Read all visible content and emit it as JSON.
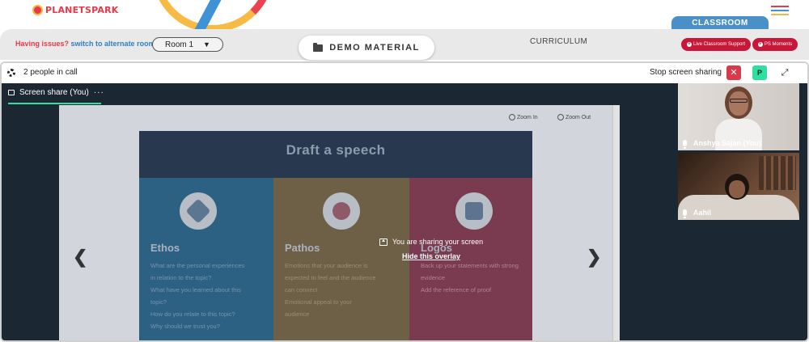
{
  "header": {
    "logo_text_a": "PLANET",
    "logo_text_b": "SPARK",
    "classroom_tab": "CLASSROOM"
  },
  "subbar": {
    "issues_question": "Having issues?",
    "issues_link": "switch to alternate room",
    "room_select": "Room 1",
    "demo_material": "DEMO MATERIAL",
    "curriculum": "CURRICULUM",
    "support_button": "Live Classroom Support",
    "moments_button": "PS Moments"
  },
  "call": {
    "people_count": "2 people in call",
    "stop_sharing": "Stop screen sharing",
    "close_glyph": "✕",
    "p_button": "P",
    "expand_glyph": "⤢",
    "share_tab": "Screen share (You)",
    "more_glyph": "···"
  },
  "screen": {
    "zoom_in": "Zoom In",
    "zoom_out": "Zoom Out",
    "prev_glyph": "❮",
    "next_glyph": "❯",
    "slide_title": "Draft a speech",
    "columns": [
      {
        "heading": "Ethos",
        "lines": [
          "What are the personal experiences",
          "in relation to the topic?",
          "What have you learned about this",
          "topic?",
          "How do you relate to this topic?",
          "Why should we trust you?"
        ]
      },
      {
        "heading": "Pathos",
        "lines": [
          "Emotions that your audience is",
          "expected to feel and the audience",
          "can connect",
          "Emotional appeal to your",
          "audience"
        ]
      },
      {
        "heading": "Logos",
        "lines": [
          "Back up your statements with strong",
          "evidence",
          "Add the reference of proof"
        ]
      }
    ],
    "overlay_message": "You are sharing your screen",
    "overlay_hide": "Hide this overlay"
  },
  "participants": [
    {
      "name": "Anshya Sajan (You)"
    },
    {
      "name": "Aahil"
    }
  ],
  "colors": {
    "brand_red": "#e8394a",
    "brand_blue": "#3f92d6",
    "brand_yellow": "#f6b73c",
    "accent_green": "#2ee0a0",
    "support_red": "#c8183a"
  }
}
